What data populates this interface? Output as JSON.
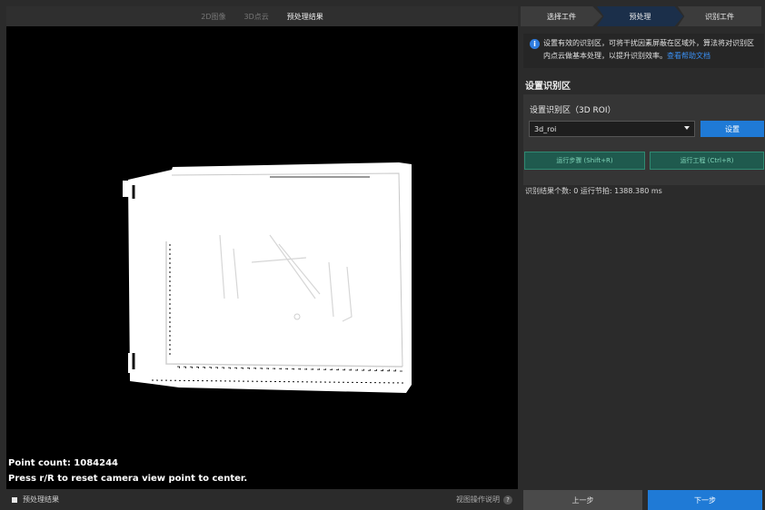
{
  "viewer": {
    "tabs": [
      "2D图像",
      "3D点云",
      "预处理结果"
    ],
    "active_tab": "预处理结果",
    "point_count": "Point count: 1084244",
    "reset_hint": "Press r/R to reset camera view point to center.",
    "preprocess_label": "预处理结果",
    "view_help_label": "视图操作说明",
    "help_icon": "question-icon",
    "help_glyph": "?"
  },
  "steps": {
    "items": [
      "选择工件",
      "预处理",
      "识别工件"
    ],
    "active": "预处理"
  },
  "info": {
    "icon": "info-icon",
    "glyph": "i",
    "text": "设置有效的识别区，可将干扰因素屏蔽在区域外，算法将对识别区内点云做基本处理，以提升识别效率。",
    "link": "查看帮助文档"
  },
  "roi": {
    "section_title": "设置识别区",
    "card_label": "设置识别区（3D ROI）",
    "selected": "3d_roi",
    "set_button": "设置"
  },
  "actions": {
    "run_step": "运行步骤 (Shift+R)",
    "run_project": "运行工程 (Ctrl+R)"
  },
  "result": {
    "text": "识别结果个数: 0    运行节拍: 1388.380 ms"
  },
  "nav": {
    "prev": "上一步",
    "next": "下一步"
  },
  "colors": {
    "accent": "#1f7ad6",
    "run_button": "#1f5a4e",
    "background": "#2b2b2b"
  }
}
